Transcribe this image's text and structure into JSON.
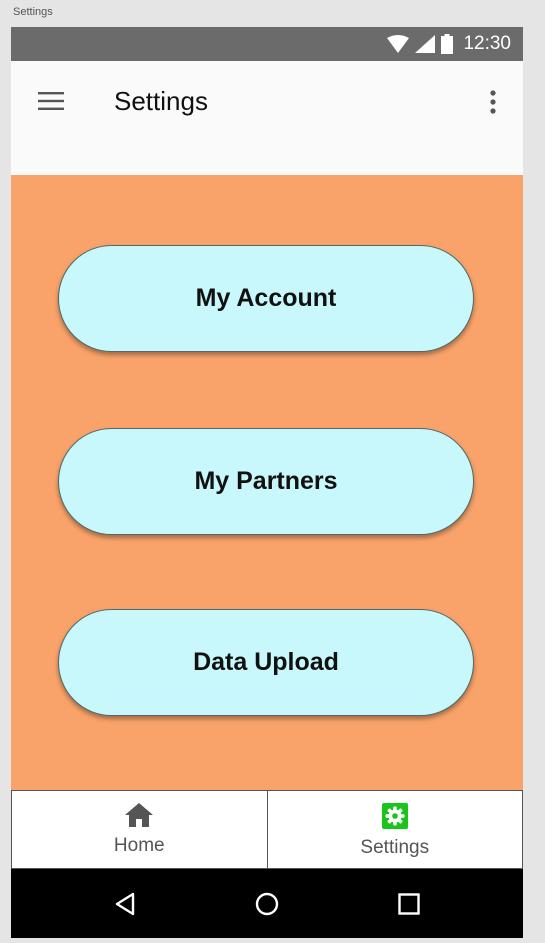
{
  "frame": {
    "label": "Settings"
  },
  "status_bar": {
    "time": "12:30",
    "icons": [
      "wifi-icon",
      "signal-icon",
      "battery-icon"
    ]
  },
  "app_bar": {
    "title": "Settings",
    "leading_icon": "menu-icon",
    "trailing_icon": "more-vert-icon"
  },
  "buttons": [
    {
      "label": "My Account"
    },
    {
      "label": "My Partners"
    },
    {
      "label": "Data Upload"
    }
  ],
  "bottom_nav": {
    "items": [
      {
        "label": "Home",
        "icon": "home-icon",
        "active": false
      },
      {
        "label": "Settings",
        "icon": "gear-icon",
        "active": true
      }
    ]
  },
  "system_nav": {
    "icons": [
      "back-icon",
      "home-circle-icon",
      "recents-icon"
    ]
  },
  "colors": {
    "status_bar": "#6b6b6b",
    "app_bar": "#fafafa",
    "content_background": "#f9a36a",
    "button_fill": "#c8f8fb",
    "active_nav_icon": "#1ac41a",
    "system_nav": "#000000"
  }
}
